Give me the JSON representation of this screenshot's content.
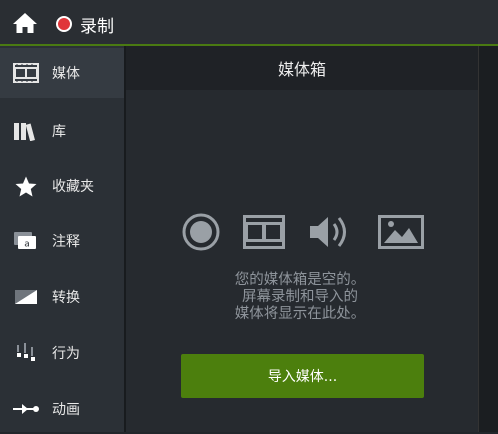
{
  "topbar": {
    "home_icon": "home-icon",
    "record_label": "录制"
  },
  "sidebar": {
    "items": [
      {
        "label": "媒体",
        "icon": "film-icon",
        "active": true
      },
      {
        "label": "库",
        "icon": "library-icon",
        "active": false
      },
      {
        "label": "收藏夹",
        "icon": "star-icon",
        "active": false
      },
      {
        "label": "注释",
        "icon": "annotation-icon",
        "active": false
      },
      {
        "label": "转换",
        "icon": "transition-icon",
        "active": false
      },
      {
        "label": "行为",
        "icon": "behavior-icon",
        "active": false
      },
      {
        "label": "动画",
        "icon": "animation-icon",
        "active": false
      }
    ]
  },
  "panel": {
    "title": "媒体箱",
    "media_types": [
      "record-icon",
      "video-icon",
      "audio-icon",
      "image-icon"
    ],
    "empty_message": [
      "您的媒体箱是空的。",
      "屏幕录制和导入的",
      "媒体将显示在此处。"
    ],
    "import_button": "导入媒体..."
  },
  "colors": {
    "accent_green": "#4c7f0d",
    "record_red": "#e0363a",
    "icon_gray": "#9aa0a6"
  }
}
